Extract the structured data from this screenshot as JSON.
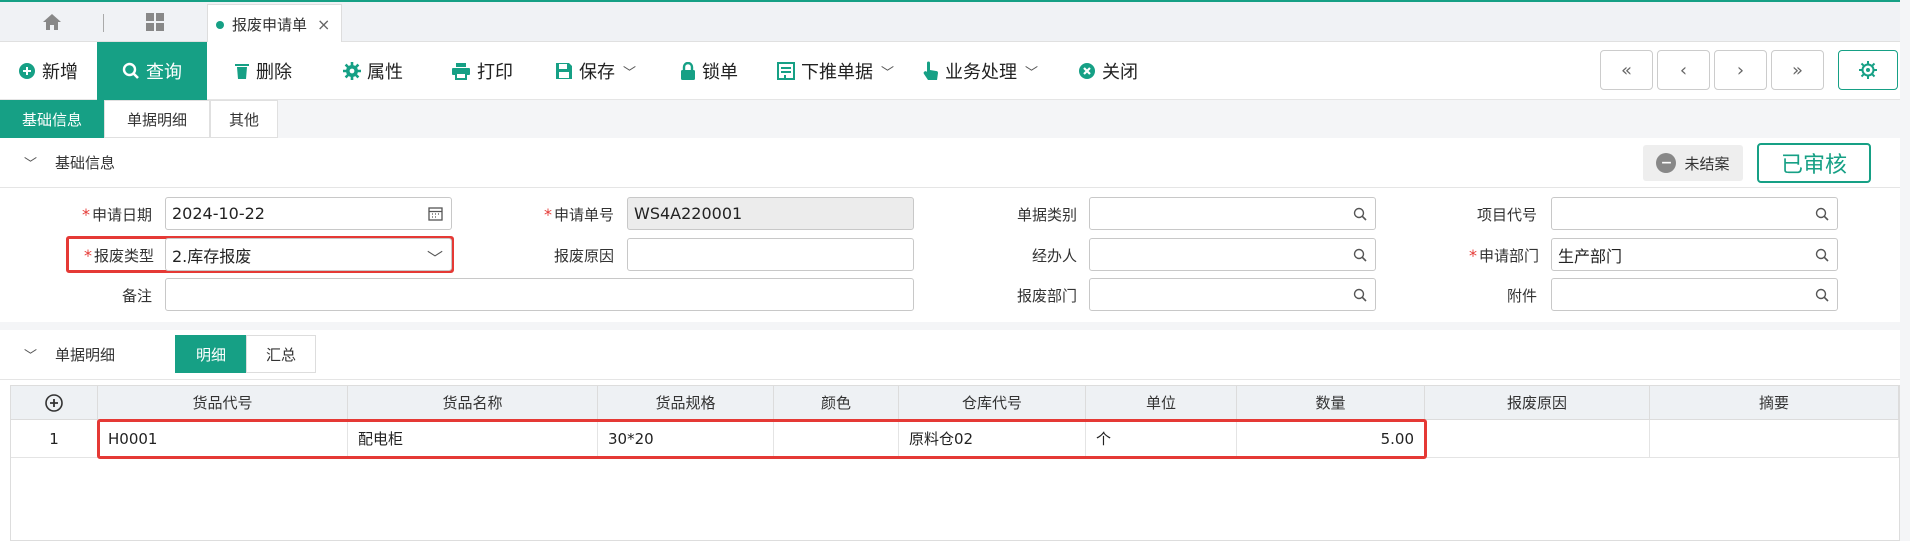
{
  "tabs": {
    "page_label": "报废申请单",
    "close_glyph": "×"
  },
  "toolbar": {
    "add": "新增",
    "query": "查询",
    "delete": "删除",
    "attr": "属性",
    "print": "打印",
    "save": "保存",
    "lock": "锁单",
    "push": "下推单据",
    "business": "业务处理",
    "close": "关闭",
    "nav": [
      "«",
      "‹",
      "›",
      "»"
    ]
  },
  "subtabs": [
    "基础信息",
    "单据明细",
    "其他"
  ],
  "basic": {
    "section_title": "基础信息",
    "status_open": "未结案",
    "status_audited": "已审核",
    "fields": {
      "apply_date_label": "申请日期",
      "apply_date": "2024-10-22",
      "apply_no_label": "申请单号",
      "apply_no": "WS4A220001",
      "doc_type_label": "单据类别",
      "doc_type": "",
      "project_label": "项目代号",
      "project": "",
      "scrap_type_label": "报废类型",
      "scrap_type": "2.库存报废",
      "scrap_reason_label": "报废原因",
      "scrap_reason": "",
      "handler_label": "经办人",
      "handler": "",
      "dept_label": "申请部门",
      "dept": "生产部门",
      "remark_label": "备注",
      "remark": "",
      "scrap_dept_label": "报废部门",
      "scrap_dept": "",
      "attach_label": "附件",
      "attach": ""
    }
  },
  "detail": {
    "section_title": "单据明细",
    "tabs": [
      "明细",
      "汇总"
    ],
    "columns": [
      "货品代号",
      "货品名称",
      "货品规格",
      "颜色",
      "仓库代号",
      "单位",
      "数量",
      "报废原因",
      "摘要"
    ],
    "rows": [
      {
        "no": "1",
        "code": "H0001",
        "name": "配电柜",
        "spec": "30*20",
        "color": "",
        "wh": "原料仓02",
        "unit": "个",
        "qty": "5.00",
        "reason": "",
        "memo": ""
      }
    ]
  }
}
